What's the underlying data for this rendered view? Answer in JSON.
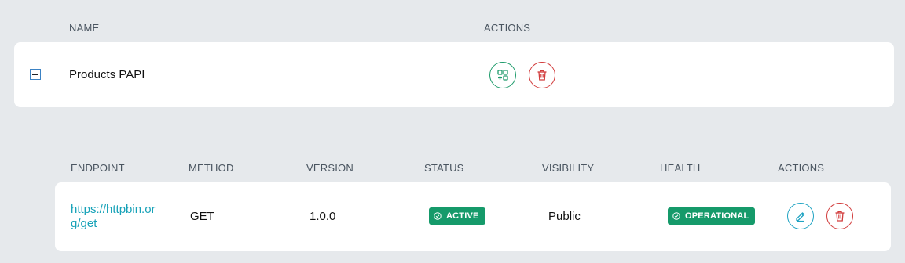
{
  "api_table": {
    "headers": {
      "name": "NAME",
      "actions": "ACTIONS"
    },
    "row": {
      "name": "Products PAPI",
      "actions": [
        {
          "icon": "add-endpoint-icon",
          "color": "#1e9b6b"
        },
        {
          "icon": "trash-icon",
          "color": "#d23c3c"
        }
      ]
    }
  },
  "endpoint_table": {
    "headers": {
      "endpoint": "ENDPOINT",
      "method": "METHOD",
      "version": "VERSION",
      "status": "STATUS",
      "visibility": "VISIBILITY",
      "health": "HEALTH",
      "actions": "ACTIONS"
    },
    "row": {
      "endpoint": "https://httpbin.org/get",
      "method": "GET",
      "version": "1.0.0",
      "status": "ACTIVE",
      "visibility": "Public",
      "health": "OPERATIONAL",
      "actions": [
        {
          "icon": "pencil-icon",
          "color": "#1fa3c2"
        },
        {
          "icon": "trash-icon",
          "color": "#d23c3c"
        }
      ]
    }
  },
  "colors": {
    "background": "#e6e9ec",
    "link": "#17a2b8",
    "badge": "#159a6a"
  }
}
